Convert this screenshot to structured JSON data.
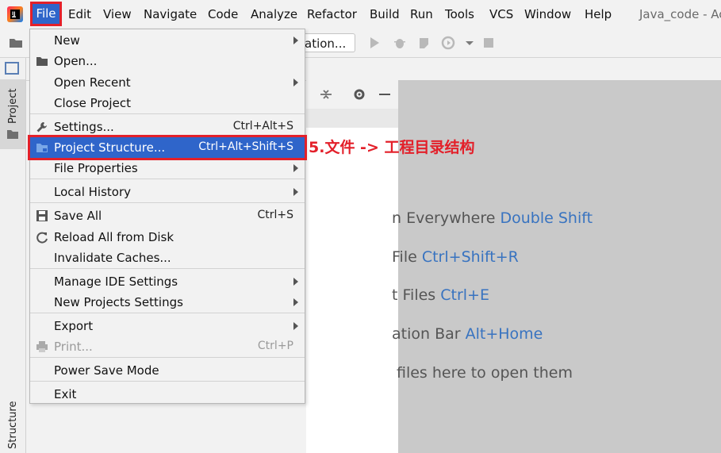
{
  "menubar": {
    "items": [
      "File",
      "Edit",
      "View",
      "Navigate",
      "Code",
      "Analyze",
      "Refactor",
      "Build",
      "Run",
      "Tools",
      "VCS",
      "Window",
      "Help"
    ],
    "title": "Java_code - Ac"
  },
  "toolbar": {
    "run_config_label": "ation..."
  },
  "sidebar": {
    "project_tab": "Project",
    "structure_tab": "Structure"
  },
  "file_menu": {
    "new": "New",
    "open": "Open...",
    "open_recent": "Open Recent",
    "close_project": "Close Project",
    "settings": "Settings...",
    "settings_shortcut": "Ctrl+Alt+S",
    "project_structure": "Project Structure...",
    "project_structure_shortcut": "Ctrl+Alt+Shift+S",
    "file_properties": "File Properties",
    "local_history": "Local History",
    "save_all": "Save All",
    "save_all_shortcut": "Ctrl+S",
    "reload": "Reload All from Disk",
    "invalidate": "Invalidate Caches...",
    "manage_ide": "Manage IDE Settings",
    "new_projects_settings": "New Projects Settings",
    "export": "Export",
    "print": "Print...",
    "print_shortcut": "Ctrl+P",
    "power_save": "Power Save Mode",
    "exit": "Exit"
  },
  "annotation": "5.文件 -> 工程目录结构",
  "editor_hints": [
    {
      "text": "n Everywhere ",
      "key": "Double Shift"
    },
    {
      "text": " File ",
      "key": "Ctrl+Shift+R"
    },
    {
      "text": "t Files ",
      "key": "Ctrl+E"
    },
    {
      "text": "ation Bar ",
      "key": "Alt+Home"
    },
    {
      "text": "files here to open them",
      "key": ""
    }
  ],
  "colors": {
    "accent": "#2f65ca",
    "highlight_border": "#e3202a",
    "hint_key": "#3873c0"
  }
}
